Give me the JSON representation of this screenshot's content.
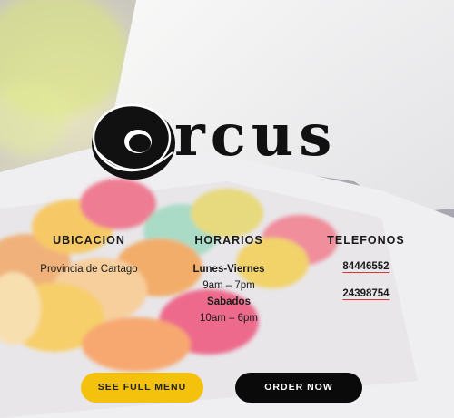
{
  "brand": {
    "name": "rcus"
  },
  "columns": {
    "ubicacion": {
      "title": "UBICACION",
      "address": "Provincia de Cartago"
    },
    "horarios": {
      "title": "HORARIOS",
      "weekday_label": "Lunes-Viernes",
      "weekday_hours": "9am – 7pm",
      "saturday_label": "Sabados",
      "saturday_hours": "10am – 6pm"
    },
    "telefonos": {
      "title": "TELEFONOS",
      "phones": [
        "84446552",
        "24398754"
      ]
    }
  },
  "buttons": {
    "menu": "SEE FULL MENU",
    "order": "ORDER NOW"
  },
  "colors": {
    "menu_button": "#f4c20d",
    "order_button": "#0a0a0a"
  }
}
